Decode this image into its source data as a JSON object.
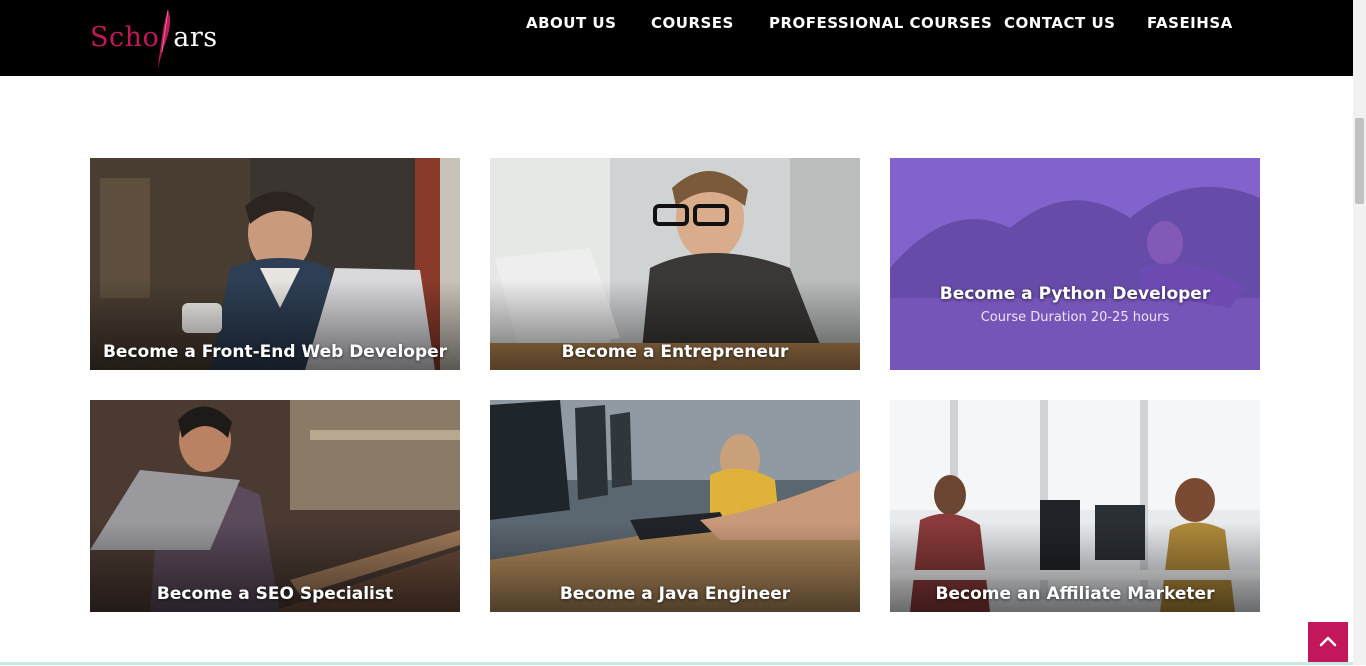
{
  "header": {
    "logo": {
      "left": "Scho",
      "right": "ars",
      "accent_color": "#c2185b"
    },
    "nav": [
      {
        "label": "ABOUT US"
      },
      {
        "label": "COURSES"
      },
      {
        "label": "PROFESSIONAL COURSES"
      },
      {
        "label": "CONTACT US"
      },
      {
        "label": "FASEIHSA"
      }
    ]
  },
  "courses": [
    {
      "title": "Become a Front-End Web Developer"
    },
    {
      "title": "Become a Entrepreneur"
    },
    {
      "title": "Become a Python Developer",
      "subtitle": "Course Duration 20-25 hours",
      "highlighted": true,
      "overlay_color": "#6e46c8"
    },
    {
      "title": "Become a SEO Specialist"
    },
    {
      "title": "Become a Java Engineer"
    },
    {
      "title": "Become an Affiliate Marketer"
    }
  ],
  "back_to_top": {
    "icon": "chevron-up-icon",
    "color": "#c2185b"
  }
}
